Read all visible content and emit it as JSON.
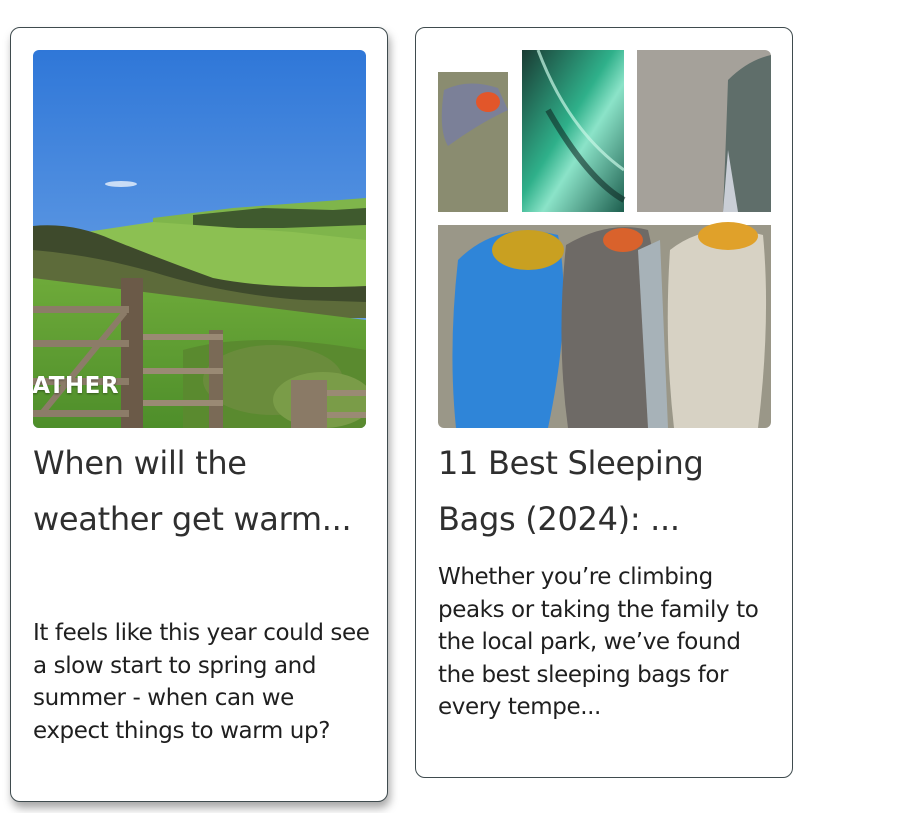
{
  "cards": [
    {
      "title": "When will the weather get warm...",
      "description": "It feels like this year could see a slow start to spring and summer - when can we expect things to warm up?",
      "image_overlay_text": "EATHER"
    },
    {
      "title": "11 Best Sleeping Bags (2024): ...",
      "description": "Whether you’re climbing peaks or taking the family to the local park, we’ve found the best sleeping bags for every tempe..."
    }
  ]
}
